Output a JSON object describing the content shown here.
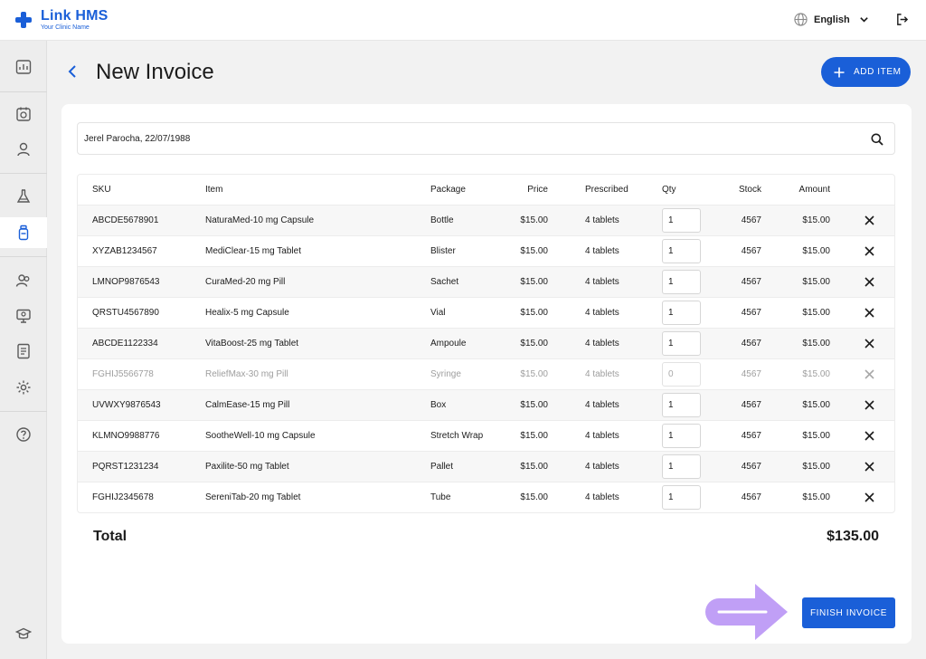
{
  "app": {
    "name": "Link HMS",
    "tagline": "Your Clinic Name",
    "brand_color": "#1a5fd8"
  },
  "header": {
    "language": "English",
    "icons": [
      "globe-icon",
      "chevron-down-icon",
      "logout-icon"
    ]
  },
  "sidebar": {
    "items": [
      {
        "icon": "dashboard-icon"
      },
      {
        "icon": "calendar-icon"
      },
      {
        "icon": "patient-icon"
      },
      {
        "icon": "lab-flask-icon"
      },
      {
        "icon": "pharmacy-bottle-icon",
        "active": true
      },
      {
        "icon": "staff-icon"
      },
      {
        "icon": "monitor-icon"
      },
      {
        "icon": "report-icon"
      },
      {
        "icon": "settings-icon"
      },
      {
        "icon": "help-icon"
      },
      {
        "icon": "training-cap-icon"
      }
    ]
  },
  "page": {
    "title": "New Invoice",
    "add_item_label": "ADD ITEM",
    "patient_value": "Jerel Parocha, 22/07/1988",
    "finish_label": "FINISH INVOICE"
  },
  "table": {
    "headers": {
      "sku": "SKU",
      "item": "Item",
      "package": "Package",
      "price": "Price",
      "prescribed": "Prescribed",
      "qty": "Qty",
      "stock": "Stock",
      "amount": "Amount"
    },
    "rows": [
      {
        "sku": "ABCDE5678901",
        "item": "NaturaMed-10 mg Capsule",
        "package": "Bottle",
        "price": "$15.00",
        "prescribed": "4 tablets",
        "qty": "1",
        "stock": "4567",
        "amount": "$15.00",
        "disabled": false
      },
      {
        "sku": "XYZAB1234567",
        "item": "MediClear-15 mg Tablet",
        "package": "Blister",
        "price": "$15.00",
        "prescribed": "4 tablets",
        "qty": "1",
        "stock": "4567",
        "amount": "$15.00",
        "disabled": false
      },
      {
        "sku": "LMNOP9876543",
        "item": "CuraMed-20 mg Pill",
        "package": "Sachet",
        "price": "$15.00",
        "prescribed": "4 tablets",
        "qty": "1",
        "stock": "4567",
        "amount": "$15.00",
        "disabled": false
      },
      {
        "sku": "QRSTU4567890",
        "item": "Healix-5 mg Capsule",
        "package": "Vial",
        "price": "$15.00",
        "prescribed": "4 tablets",
        "qty": "1",
        "stock": "4567",
        "amount": "$15.00",
        "disabled": false
      },
      {
        "sku": "ABCDE1122334",
        "item": "VitaBoost-25 mg Tablet",
        "package": "Ampoule",
        "price": "$15.00",
        "prescribed": "4 tablets",
        "qty": "1",
        "stock": "4567",
        "amount": "$15.00",
        "disabled": false
      },
      {
        "sku": "FGHIJ5566778",
        "item": "ReliefMax-30 mg Pill",
        "package": "Syringe",
        "price": "$15.00",
        "prescribed": "4 tablets",
        "qty": "0",
        "stock": "4567",
        "amount": "$15.00",
        "disabled": true
      },
      {
        "sku": "UVWXY9876543",
        "item": "CalmEase-15 mg Pill",
        "package": "Box",
        "price": "$15.00",
        "prescribed": "4 tablets",
        "qty": "1",
        "stock": "4567",
        "amount": "$15.00",
        "disabled": false
      },
      {
        "sku": "KLMNO9988776",
        "item": "SootheWell-10 mg Capsule",
        "package": "Stretch Wrap",
        "price": "$15.00",
        "prescribed": "4 tablets",
        "qty": "1",
        "stock": "4567",
        "amount": "$15.00",
        "disabled": false
      },
      {
        "sku": "PQRST1231234",
        "item": "Paxilite-50 mg Tablet",
        "package": "Pallet",
        "price": "$15.00",
        "prescribed": "4 tablets",
        "qty": "1",
        "stock": "4567",
        "amount": "$15.00",
        "disabled": false
      },
      {
        "sku": "FGHIJ2345678",
        "item": "SereniTab-20 mg Tablet",
        "package": "Tube",
        "price": "$15.00",
        "prescribed": "4 tablets",
        "qty": "1",
        "stock": "4567",
        "amount": "$15.00",
        "disabled": false
      }
    ]
  },
  "total": {
    "label": "Total",
    "value": "$135.00"
  },
  "hint": {
    "icon": "arrow-right-icon",
    "color": "#b58ef5"
  }
}
